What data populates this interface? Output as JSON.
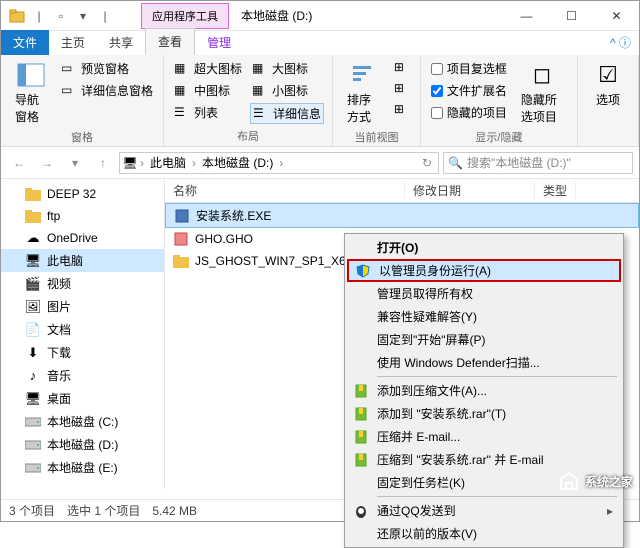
{
  "titlebar": {
    "tool_tab": "应用程序工具",
    "title": "本地磁盘 (D:)"
  },
  "winbtns": {
    "min": "—",
    "max": "☐",
    "close": "✕"
  },
  "tabs": {
    "file": "文件",
    "home": "主页",
    "share": "共享",
    "view": "查看",
    "manage": "管理"
  },
  "ribbon": {
    "panes": {
      "label": "窗格",
      "nav": "导航窗格",
      "preview": "预览窗格",
      "detailpane": "详细信息窗格"
    },
    "layout": {
      "label": "布局",
      "xl": "超大图标",
      "l": "大图标",
      "m": "中图标",
      "s": "小图标",
      "list": "列表",
      "details": "详细信息"
    },
    "current": {
      "label": "当前视图",
      "sort": "排序方式"
    },
    "showhide": {
      "label": "显示/隐藏",
      "chk1": "项目复选框",
      "chk2": "文件扩展名",
      "chk3": "隐藏的项目",
      "hide": "隐藏所选项目"
    },
    "options": "选项"
  },
  "addr": {
    "pc": "此电脑",
    "drive": "本地磁盘 (D:)",
    "search_ph": "搜索\"本地磁盘 (D:)\""
  },
  "nav": [
    {
      "icon": "folder",
      "label": "DEEP 32"
    },
    {
      "icon": "folder",
      "label": "ftp"
    },
    {
      "icon": "cloud",
      "label": "OneDrive"
    },
    {
      "icon": "pc",
      "label": "此电脑",
      "sel": true
    },
    {
      "icon": "video",
      "label": "视频"
    },
    {
      "icon": "pic",
      "label": "图片"
    },
    {
      "icon": "doc",
      "label": "文档"
    },
    {
      "icon": "dl",
      "label": "下载"
    },
    {
      "icon": "music",
      "label": "音乐"
    },
    {
      "icon": "desk",
      "label": "桌面"
    },
    {
      "icon": "drive",
      "label": "本地磁盘 (C:)"
    },
    {
      "icon": "drive",
      "label": "本地磁盘 (D:)"
    },
    {
      "icon": "drive",
      "label": "本地磁盘 (E:)"
    }
  ],
  "cols": {
    "name": "名称",
    "date": "修改日期",
    "type": "类型"
  },
  "files": [
    {
      "icon": "exe",
      "name": "安装系统.EXE",
      "sel": true
    },
    {
      "icon": "gho",
      "name": "GHO.GHO"
    },
    {
      "icon": "folder",
      "name": "JS_GHOST_WIN7_SP1_X64_..."
    }
  ],
  "ctx": [
    {
      "label": "打开(O)",
      "bold": true
    },
    {
      "label": "以管理员身份运行(A)",
      "icon": "shield",
      "hl": true,
      "hov": true
    },
    {
      "label": "管理员取得所有权"
    },
    {
      "label": "兼容性疑难解答(Y)"
    },
    {
      "label": "固定到\"开始\"屏幕(P)"
    },
    {
      "label": "使用 Windows Defender扫描..."
    },
    {
      "sep": true
    },
    {
      "label": "添加到压缩文件(A)...",
      "icon": "rar"
    },
    {
      "label": "添加到 \"安装系统.rar\"(T)",
      "icon": "rar"
    },
    {
      "label": "压缩并 E-mail...",
      "icon": "rar"
    },
    {
      "label": "压缩到 \"安装系统.rar\" 并 E-mail",
      "icon": "rar"
    },
    {
      "label": "固定到任务栏(K)"
    },
    {
      "sep": true
    },
    {
      "label": "通过QQ发送到",
      "icon": "qq",
      "arrow": true
    },
    {
      "label": "还原以前的版本(V)"
    }
  ],
  "status": {
    "count": "3 个项目",
    "sel": "选中 1 个项目",
    "size": "5.42 MB"
  },
  "watermark": "系统之家"
}
